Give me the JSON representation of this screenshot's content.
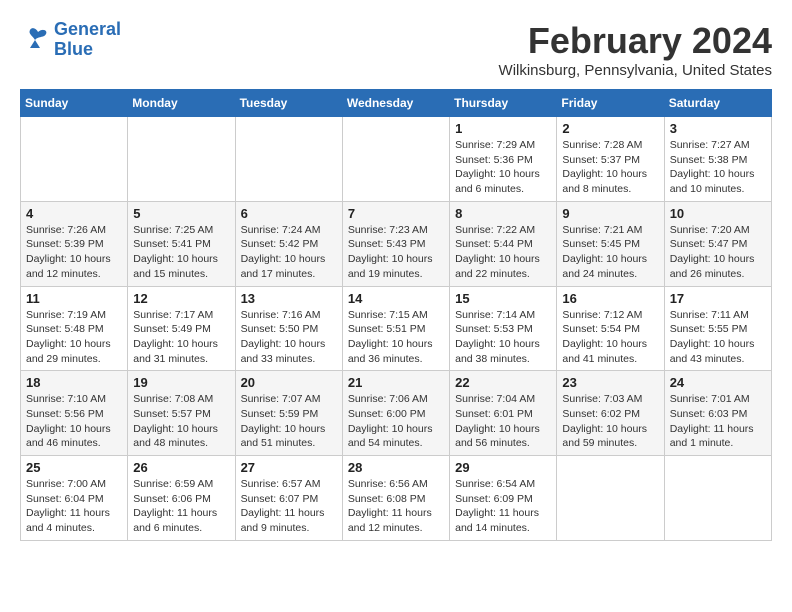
{
  "logo": {
    "line1": "General",
    "line2": "Blue"
  },
  "title": "February 2024",
  "subtitle": "Wilkinsburg, Pennsylvania, United States",
  "days_of_week": [
    "Sunday",
    "Monday",
    "Tuesday",
    "Wednesday",
    "Thursday",
    "Friday",
    "Saturday"
  ],
  "weeks": [
    [
      {
        "day": "",
        "info": ""
      },
      {
        "day": "",
        "info": ""
      },
      {
        "day": "",
        "info": ""
      },
      {
        "day": "",
        "info": ""
      },
      {
        "day": "1",
        "info": "Sunrise: 7:29 AM\nSunset: 5:36 PM\nDaylight: 10 hours and 6 minutes."
      },
      {
        "day": "2",
        "info": "Sunrise: 7:28 AM\nSunset: 5:37 PM\nDaylight: 10 hours and 8 minutes."
      },
      {
        "day": "3",
        "info": "Sunrise: 7:27 AM\nSunset: 5:38 PM\nDaylight: 10 hours and 10 minutes."
      }
    ],
    [
      {
        "day": "4",
        "info": "Sunrise: 7:26 AM\nSunset: 5:39 PM\nDaylight: 10 hours and 12 minutes."
      },
      {
        "day": "5",
        "info": "Sunrise: 7:25 AM\nSunset: 5:41 PM\nDaylight: 10 hours and 15 minutes."
      },
      {
        "day": "6",
        "info": "Sunrise: 7:24 AM\nSunset: 5:42 PM\nDaylight: 10 hours and 17 minutes."
      },
      {
        "day": "7",
        "info": "Sunrise: 7:23 AM\nSunset: 5:43 PM\nDaylight: 10 hours and 19 minutes."
      },
      {
        "day": "8",
        "info": "Sunrise: 7:22 AM\nSunset: 5:44 PM\nDaylight: 10 hours and 22 minutes."
      },
      {
        "day": "9",
        "info": "Sunrise: 7:21 AM\nSunset: 5:45 PM\nDaylight: 10 hours and 24 minutes."
      },
      {
        "day": "10",
        "info": "Sunrise: 7:20 AM\nSunset: 5:47 PM\nDaylight: 10 hours and 26 minutes."
      }
    ],
    [
      {
        "day": "11",
        "info": "Sunrise: 7:19 AM\nSunset: 5:48 PM\nDaylight: 10 hours and 29 minutes."
      },
      {
        "day": "12",
        "info": "Sunrise: 7:17 AM\nSunset: 5:49 PM\nDaylight: 10 hours and 31 minutes."
      },
      {
        "day": "13",
        "info": "Sunrise: 7:16 AM\nSunset: 5:50 PM\nDaylight: 10 hours and 33 minutes."
      },
      {
        "day": "14",
        "info": "Sunrise: 7:15 AM\nSunset: 5:51 PM\nDaylight: 10 hours and 36 minutes."
      },
      {
        "day": "15",
        "info": "Sunrise: 7:14 AM\nSunset: 5:53 PM\nDaylight: 10 hours and 38 minutes."
      },
      {
        "day": "16",
        "info": "Sunrise: 7:12 AM\nSunset: 5:54 PM\nDaylight: 10 hours and 41 minutes."
      },
      {
        "day": "17",
        "info": "Sunrise: 7:11 AM\nSunset: 5:55 PM\nDaylight: 10 hours and 43 minutes."
      }
    ],
    [
      {
        "day": "18",
        "info": "Sunrise: 7:10 AM\nSunset: 5:56 PM\nDaylight: 10 hours and 46 minutes."
      },
      {
        "day": "19",
        "info": "Sunrise: 7:08 AM\nSunset: 5:57 PM\nDaylight: 10 hours and 48 minutes."
      },
      {
        "day": "20",
        "info": "Sunrise: 7:07 AM\nSunset: 5:59 PM\nDaylight: 10 hours and 51 minutes."
      },
      {
        "day": "21",
        "info": "Sunrise: 7:06 AM\nSunset: 6:00 PM\nDaylight: 10 hours and 54 minutes."
      },
      {
        "day": "22",
        "info": "Sunrise: 7:04 AM\nSunset: 6:01 PM\nDaylight: 10 hours and 56 minutes."
      },
      {
        "day": "23",
        "info": "Sunrise: 7:03 AM\nSunset: 6:02 PM\nDaylight: 10 hours and 59 minutes."
      },
      {
        "day": "24",
        "info": "Sunrise: 7:01 AM\nSunset: 6:03 PM\nDaylight: 11 hours and 1 minute."
      }
    ],
    [
      {
        "day": "25",
        "info": "Sunrise: 7:00 AM\nSunset: 6:04 PM\nDaylight: 11 hours and 4 minutes."
      },
      {
        "day": "26",
        "info": "Sunrise: 6:59 AM\nSunset: 6:06 PM\nDaylight: 11 hours and 6 minutes."
      },
      {
        "day": "27",
        "info": "Sunrise: 6:57 AM\nSunset: 6:07 PM\nDaylight: 11 hours and 9 minutes."
      },
      {
        "day": "28",
        "info": "Sunrise: 6:56 AM\nSunset: 6:08 PM\nDaylight: 11 hours and 12 minutes."
      },
      {
        "day": "29",
        "info": "Sunrise: 6:54 AM\nSunset: 6:09 PM\nDaylight: 11 hours and 14 minutes."
      },
      {
        "day": "",
        "info": ""
      },
      {
        "day": "",
        "info": ""
      }
    ]
  ]
}
